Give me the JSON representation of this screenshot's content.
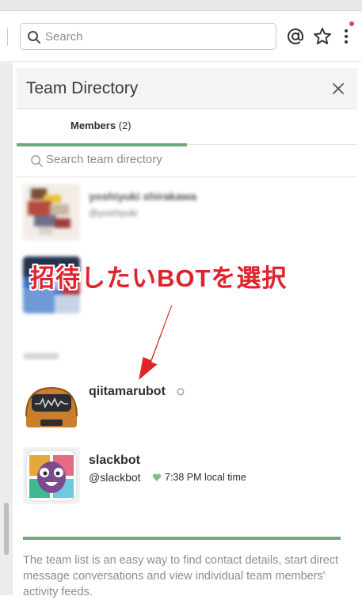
{
  "search": {
    "placeholder": "Search"
  },
  "header": {
    "icons": [
      "search-icon",
      "at-mention-icon",
      "star-icon",
      "more-vertical-icon"
    ]
  },
  "panel": {
    "title": "Team Directory",
    "tabs": [
      {
        "label": "Members",
        "count": "(2)"
      }
    ],
    "directory_search_placeholder": "Search team directory"
  },
  "members": [
    {
      "name": "yoshiyuki shirakawa",
      "handle": "@yoshiyuki",
      "blurred": true
    },
    {
      "name": "",
      "handle": "",
      "blurred": true
    },
    {
      "name": "qiitamarubot",
      "status": "away"
    },
    {
      "name": "slackbot",
      "handle": "@slackbot",
      "local_time": "7:38 PM local time"
    }
  ],
  "annotation": {
    "text": "招待したいBOTを選択",
    "color": "#e0222b"
  },
  "footer": {
    "text": "The team list is an easy way to find contact details, start direct message conversations and view individual team members' activity feeds."
  },
  "colors": {
    "accent_green": "#6ea77b",
    "notification_red": "#e0474a"
  }
}
